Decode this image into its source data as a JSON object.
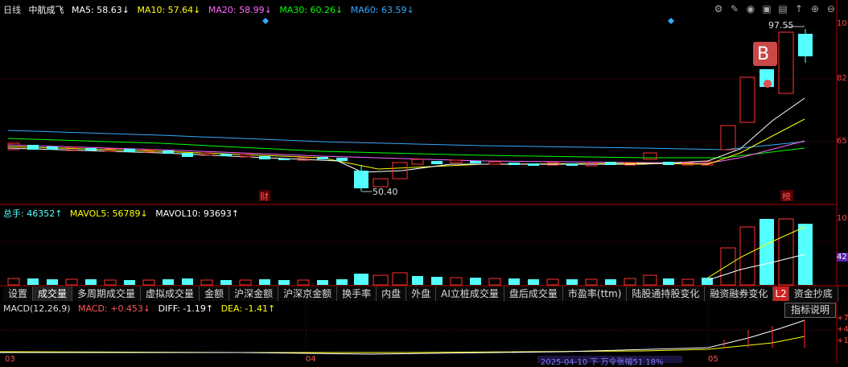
{
  "header": {
    "period": "日线",
    "stock_name": "中航成飞",
    "ma5": "MA5: 58.63↓",
    "ma10": "MA10: 57.64↓",
    "ma20": "MA20: 58.99↓",
    "ma30": "MA30: 60.26↓",
    "ma60": "MA60: 63.59↓"
  },
  "price_axis": {
    "top": "10",
    "mid": "82",
    "low": "65"
  },
  "annotations": {
    "high_label": "97.55",
    "low_label": "50.40",
    "b_marker": "B",
    "cai_marker": "财",
    "bang_marker": "榜"
  },
  "volume": {
    "total": "总手: 46352↑",
    "mavol5": "MAVOL5: 56789↓",
    "mavol10": "MAVOL10: 93693↑",
    "axis_top": "10",
    "axis_label": "42"
  },
  "tabs": [
    {
      "label": "设置"
    },
    {
      "label": "成交量"
    },
    {
      "label": "多周期成交量"
    },
    {
      "label": "虚拟成交量"
    },
    {
      "label": "金额"
    },
    {
      "label": "沪深金额"
    },
    {
      "label": "沪深京金额"
    },
    {
      "label": "换手率"
    },
    {
      "label": "内盘"
    },
    {
      "label": "外盘"
    },
    {
      "label": "AI立桩成交量"
    },
    {
      "label": "盘后成交量"
    },
    {
      "label": "市盈率(ttm)"
    },
    {
      "label": "陆股通持股变化"
    },
    {
      "label": "融资融券变化"
    },
    {
      "label": "L2"
    },
    {
      "label": "资金抄底"
    }
  ],
  "macd": {
    "name": "MACD(12,26,9)",
    "macd": "MACD: +0.453↓",
    "diff": "DIFF: -1.19↑",
    "dea": "DEA: -1.41↑",
    "button": "指标说明",
    "axis_top": "+7",
    "axis_mid": "+4",
    "axis_low": "+1"
  },
  "date_axis": {
    "d1": "03",
    "d2": "04",
    "d3": "05"
  },
  "tooltip": "2025-04-10 下 万令张幅51.18%",
  "colors": {
    "up": "#ff3333",
    "down": "#54ffff",
    "ma5": "#ffffff",
    "ma10": "#ffff00",
    "ma20": "#ff66ff",
    "ma30": "#00ff00",
    "ma60": "#33aaff"
  }
}
